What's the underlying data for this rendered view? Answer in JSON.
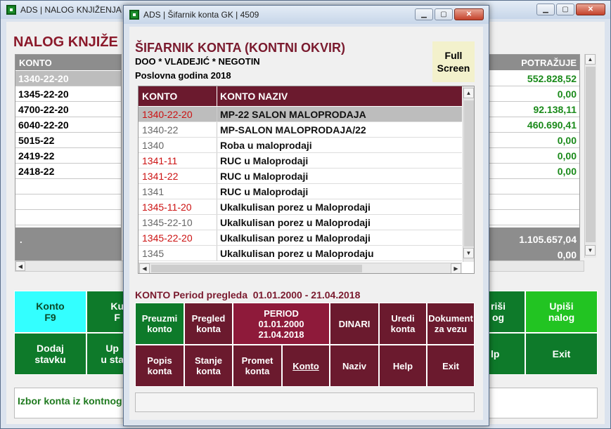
{
  "bg_window": {
    "title": "ADS | NALOG KNJIŽENJA GK",
    "heading": "NALOG KNJIŽE",
    "col_konto": "KONTO",
    "col_potrazuje": "POTRAŽUJE",
    "kontos": [
      "1340-22-20",
      "1345-22-20",
      "4700-22-20",
      "6040-22-20",
      "5015-22",
      "2419-22",
      "2418-22"
    ],
    "potrazuje": [
      "552.828,52",
      "0,00",
      "92.138,11",
      "460.690,41",
      "0,00",
      "0,00",
      "0,00"
    ],
    "sum_dot": ".",
    "total1": "1.105.657,04",
    "total2": "0,00",
    "buttons": {
      "konto": "Konto\nF9",
      "kup": "Ku\nF",
      "dodaj": "Dodaj\nstavku",
      "up": "Up\nu sta",
      "upisi_nog": "riši\nog",
      "upisi_nalog": "Upiši\nnalog",
      "lp": "lp",
      "exit": "Exit"
    },
    "status": "Izbor konta iz kontnog o"
  },
  "dialog": {
    "title": "ADS | Šifarnik konta GK | 4509",
    "heading": "ŠIFARNIK KONTA (KONTNI OKVIR)",
    "company": "DOO * VLADEJIĆ * NEGOTIN",
    "year": "Poslovna godina 2018",
    "fullscreen": "Full\nScreen",
    "col_konto": "KONTO",
    "col_naziv": "KONTO NAZIV",
    "rows": [
      {
        "konto": "1340-22-20",
        "naziv": "MP-22 SALON MALOPRODAJA",
        "color": "#cc1111"
      },
      {
        "konto": "1340-22",
        "naziv": "MP-SALON MALOPRODAJA/22",
        "color": "#666666"
      },
      {
        "konto": "1340",
        "naziv": "Roba u maloprodaji",
        "color": "#666666"
      },
      {
        "konto": "1341-11",
        "naziv": "RUC u Maloprodaji",
        "color": "#cc1111"
      },
      {
        "konto": "1341-22",
        "naziv": "RUC u Maloprodaji",
        "color": "#cc1111"
      },
      {
        "konto": "1341",
        "naziv": "RUC u Maloprodaji",
        "color": "#666666"
      },
      {
        "konto": "1345-11-20",
        "naziv": "Ukalkulisan porez u Maloprodaji",
        "color": "#cc1111"
      },
      {
        "konto": "1345-22-10",
        "naziv": "Ukalkulisan porez u Maloprodaji",
        "color": "#666666"
      },
      {
        "konto": "1345-22-20",
        "naziv": "Ukalkulisan porez u Maloprodaji",
        "color": "#cc1111"
      },
      {
        "konto": "1345",
        "naziv": "Ukalkulisan porez u Maloprodaju",
        "color": "#666666"
      }
    ],
    "period_label": "KONTO Period pregleda  01.01.2000 - 21.04.2018",
    "buttons": {
      "preuzmi": "Preuzmi\nkonto",
      "pregled": "Pregled\nkonta",
      "period": "PERIOD\n01.01.2000\n21.04.2018",
      "dinari": "DINARI",
      "uredi": "Uredi\nkonta",
      "dokument": "Dokument\nza vezu",
      "popis": "Popis\nkonta",
      "stanje": "Stanje\nkonta",
      "promet": "Promet\nkonta",
      "konto": "Konto",
      "naziv": "Naziv",
      "help": "Help",
      "exit": "Exit"
    }
  }
}
